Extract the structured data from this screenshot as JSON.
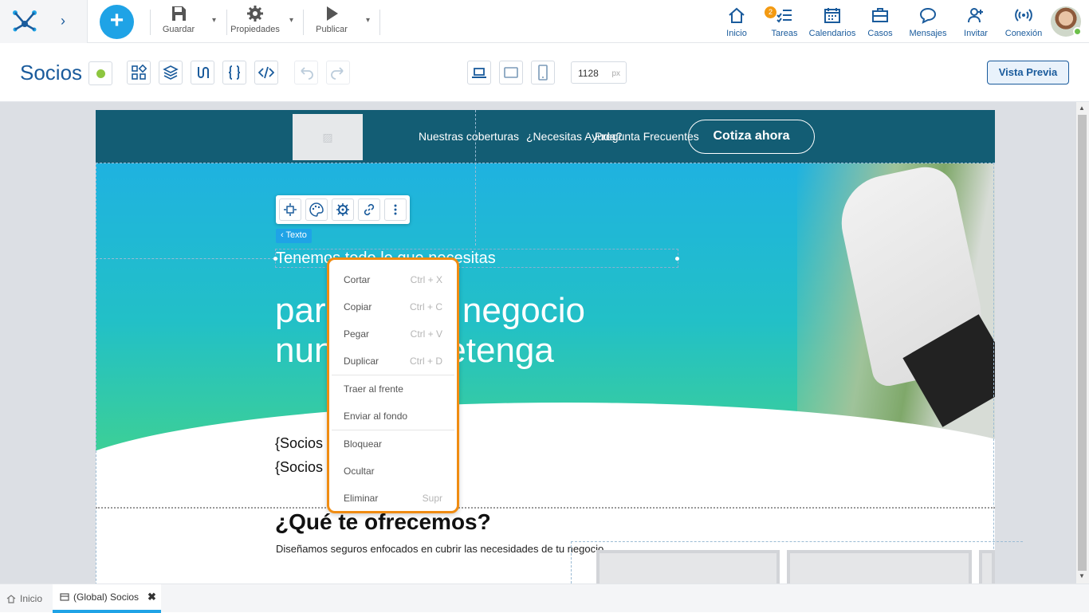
{
  "topbar": {
    "toolbar": [
      {
        "label": "Guardar",
        "icon": "save-icon"
      },
      {
        "label": "Propiedades",
        "icon": "gear-icon"
      },
      {
        "label": "Publicar",
        "icon": "play-icon"
      }
    ],
    "nav": [
      {
        "label": "Inicio",
        "icon": "home-icon"
      },
      {
        "label": "Tareas",
        "icon": "tasks-icon",
        "badge": "2"
      },
      {
        "label": "Calendarios",
        "icon": "calendar-icon"
      },
      {
        "label": "Casos",
        "icon": "briefcase-icon"
      },
      {
        "label": "Mensajes",
        "icon": "chat-icon"
      },
      {
        "label": "Invitar",
        "icon": "add-user-icon"
      },
      {
        "label": "Conexión",
        "icon": "signal-icon"
      }
    ]
  },
  "editor": {
    "title": "Socios",
    "width_value": "1128",
    "width_unit": "px",
    "preview_label": "Vista Previa"
  },
  "site": {
    "nav": [
      "Nuestras coberturas",
      "¿Necesitas Ayuda?",
      "Pregunta Frecuentes"
    ],
    "cta": "Cotiza ahora",
    "hero_small": "Tenemos todo lo que necesitas",
    "hero_line1": "para que tu negocio",
    "hero_line2": "nunca se detenga",
    "socios_line1": "{Socios",
    "socios_line2": "{Socios",
    "section_title": "¿Qué te ofrecemos?",
    "section_subtitle": "Diseñamos seguros enfocados en cubrir las necesidades de tu negocio"
  },
  "selection": {
    "tag": "Texto"
  },
  "context_menu": {
    "items": [
      {
        "label": "Cortar",
        "shortcut": "Ctrl + X"
      },
      {
        "label": "Copiar",
        "shortcut": "Ctrl + C"
      },
      {
        "label": "Pegar",
        "shortcut": "Ctrl + V"
      },
      {
        "label": "Duplicar",
        "shortcut": "Ctrl + D"
      },
      {
        "label": "Traer al frente",
        "shortcut": ""
      },
      {
        "label": "Enviar al fondo",
        "shortcut": ""
      },
      {
        "label": "Bloquear",
        "shortcut": ""
      },
      {
        "label": "Ocultar",
        "shortcut": ""
      },
      {
        "label": "Eliminar",
        "shortcut": "Supr"
      }
    ]
  },
  "tabs": [
    {
      "label": "Inicio"
    },
    {
      "label": "(Global) Socios"
    }
  ],
  "colors": {
    "accent": "#1fa3e6",
    "brand": "#1a5b9c",
    "highlight": "#f08c12"
  }
}
